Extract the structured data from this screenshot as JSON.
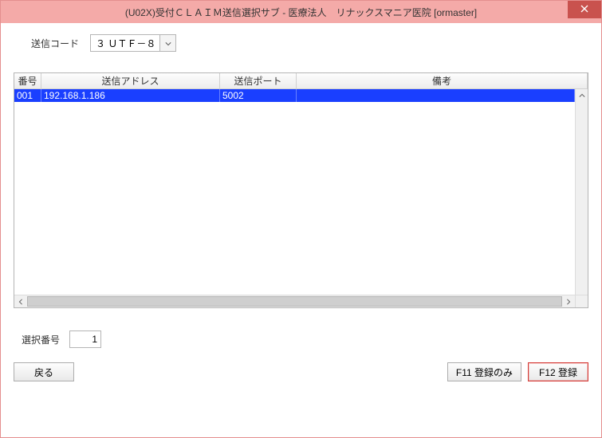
{
  "window": {
    "title": "(U02X)受付ＣＬＡＩＭ送信選択サブ - 医療法人　リナックスマニア医院  [ormaster]"
  },
  "encoding": {
    "label": "送信コード",
    "value": "３ ＵＴＦ－８"
  },
  "table": {
    "headers": {
      "num": "番号",
      "addr": "送信アドレス",
      "port": "送信ポート",
      "memo": "備考"
    },
    "rows": [
      {
        "num": "001",
        "addr": "192.168.1.186",
        "port": "5002",
        "memo": ""
      }
    ]
  },
  "selection": {
    "label": "選択番号",
    "value": "1"
  },
  "buttons": {
    "back": "戻る",
    "f11": "F11 登録のみ",
    "f12": "F12 登録"
  }
}
